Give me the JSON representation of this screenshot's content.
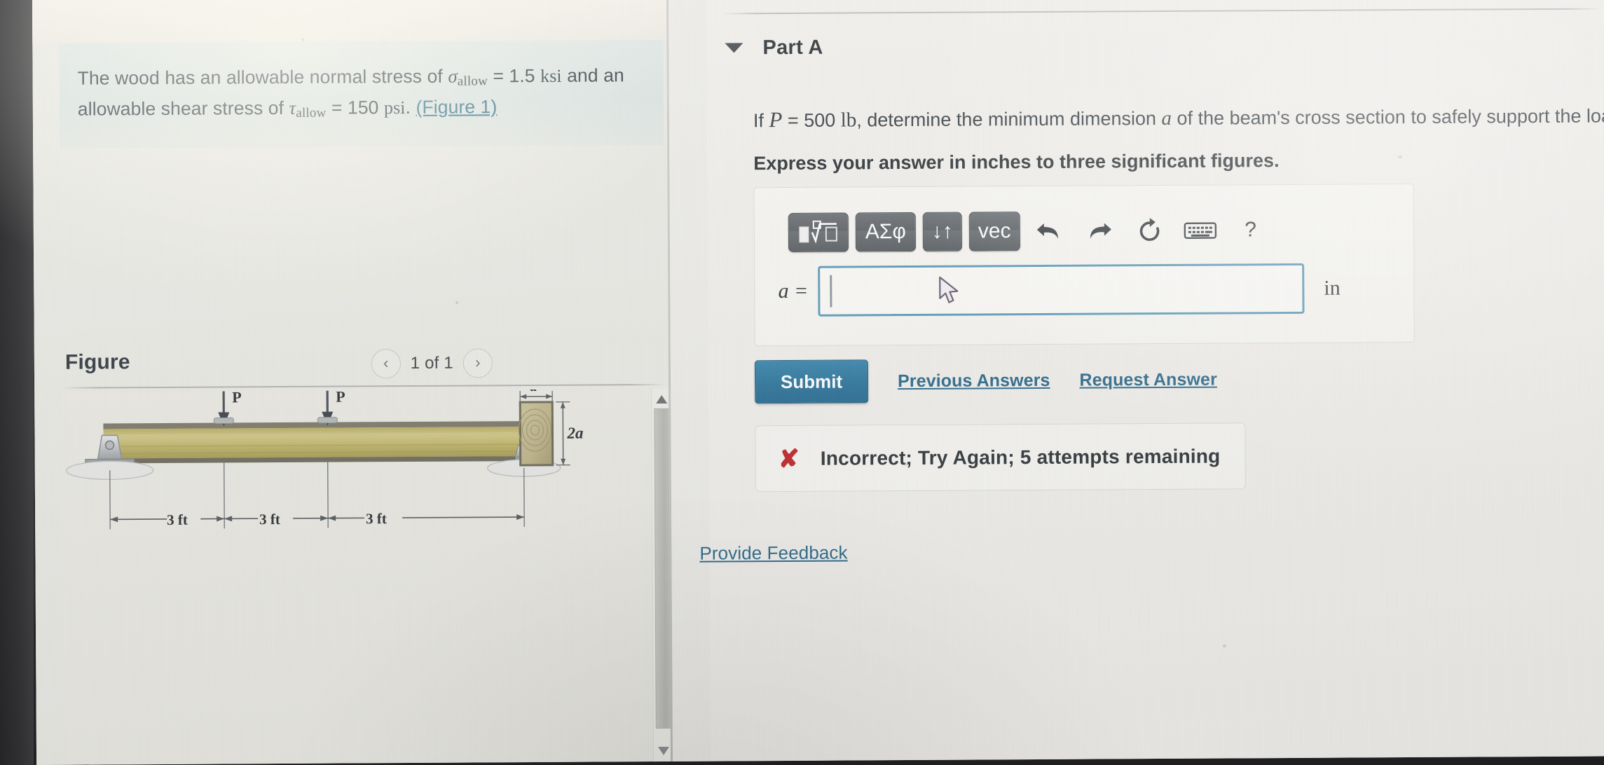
{
  "problem": {
    "text_line1_pre": "The wood has an allowable normal stress of ",
    "sigma_symbol": "σ",
    "sigma_sub": "allow",
    "sigma_value": " = 1.5 ",
    "sigma_unit": "ksi",
    "text_line1_post": " and an",
    "text_line2_pre": "allowable shear stress of ",
    "tau_symbol": "τ",
    "tau_sub": "allow",
    "tau_value": " = 150 ",
    "tau_unit": "psi",
    "text_line2_post": ". ",
    "figure_link": "(Figure 1)"
  },
  "figure_panel": {
    "title": "Figure",
    "prev_icon": "‹",
    "next_icon": "›",
    "page_label": "1 of 1",
    "scroll_up_icon": "▲",
    "scroll_down_icon": "▼",
    "diagram": {
      "load_label_left": "P",
      "load_label_right": "P",
      "dim_1": "3 ft",
      "dim_2": "3 ft",
      "dim_3": "3 ft",
      "section_width_label": "a",
      "section_height_label": "2a"
    }
  },
  "part": {
    "caret_icon": "triangle-down",
    "title": "Part A",
    "question_pre": "If ",
    "question_P": "P",
    "question_mid": " = 500 ",
    "question_unit": "lb",
    "question_mid2": ", determine the minimum dimension ",
    "question_var": "a",
    "question_post": " of the beam's cross section to safely support the loa",
    "express": "Express your answer in inches to three significant figures."
  },
  "toolbar": {
    "template_button": "▣√▢",
    "greek_button": "ΑΣφ",
    "updown_button": "↓↑",
    "vec_button": "vec",
    "undo_icon": "undo-arrow",
    "redo_icon": "redo-arrow",
    "reset_icon": "reset-circular-arrow",
    "keyboard_icon": "keyboard",
    "help_button": "?"
  },
  "answer": {
    "label": "a =",
    "value": "",
    "unit": "in"
  },
  "actions": {
    "submit_label": "Submit",
    "previous_answers_label": "Previous Answers",
    "request_answer_label": "Request Answer",
    "provide_feedback_label": "Provide Feedback"
  },
  "feedback": {
    "icon": "✘",
    "message": "Incorrect; Try Again; 5 attempts remaining",
    "icon_color": "#c0282c"
  },
  "colors": {
    "statement_background": "#dbe5e3",
    "submit_blue": "#2f769c",
    "link_blue": "#2d6b8c",
    "input_focus_border": "#5e9cb8",
    "beam_wood": "#c5bc72",
    "error_red": "#c0282c"
  }
}
